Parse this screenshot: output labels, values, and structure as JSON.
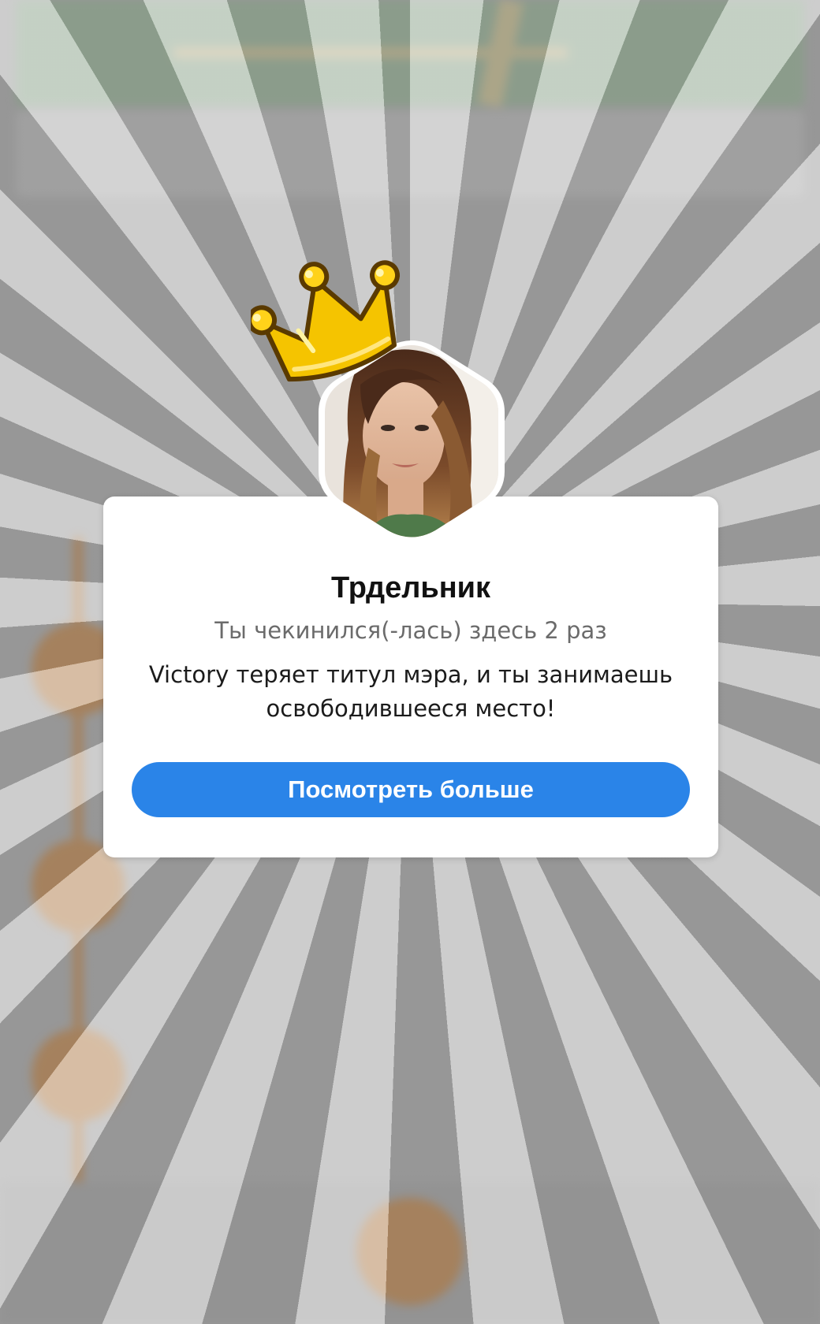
{
  "dialog": {
    "venue_name": "Трдельник",
    "checkin_text": "Ты чекинился(-лась) здесь 2 раз",
    "mayor_message": "Victory теряет титул мэра, и ты занимаешь освободившееся место!",
    "button_label": "Посмотреть больше"
  },
  "icons": {
    "crown": "crown-icon",
    "avatar": "user-avatar"
  },
  "colors": {
    "button": "#2a84e8",
    "accent_orange": "#c8792a",
    "crown_yellow": "#f5c400"
  }
}
